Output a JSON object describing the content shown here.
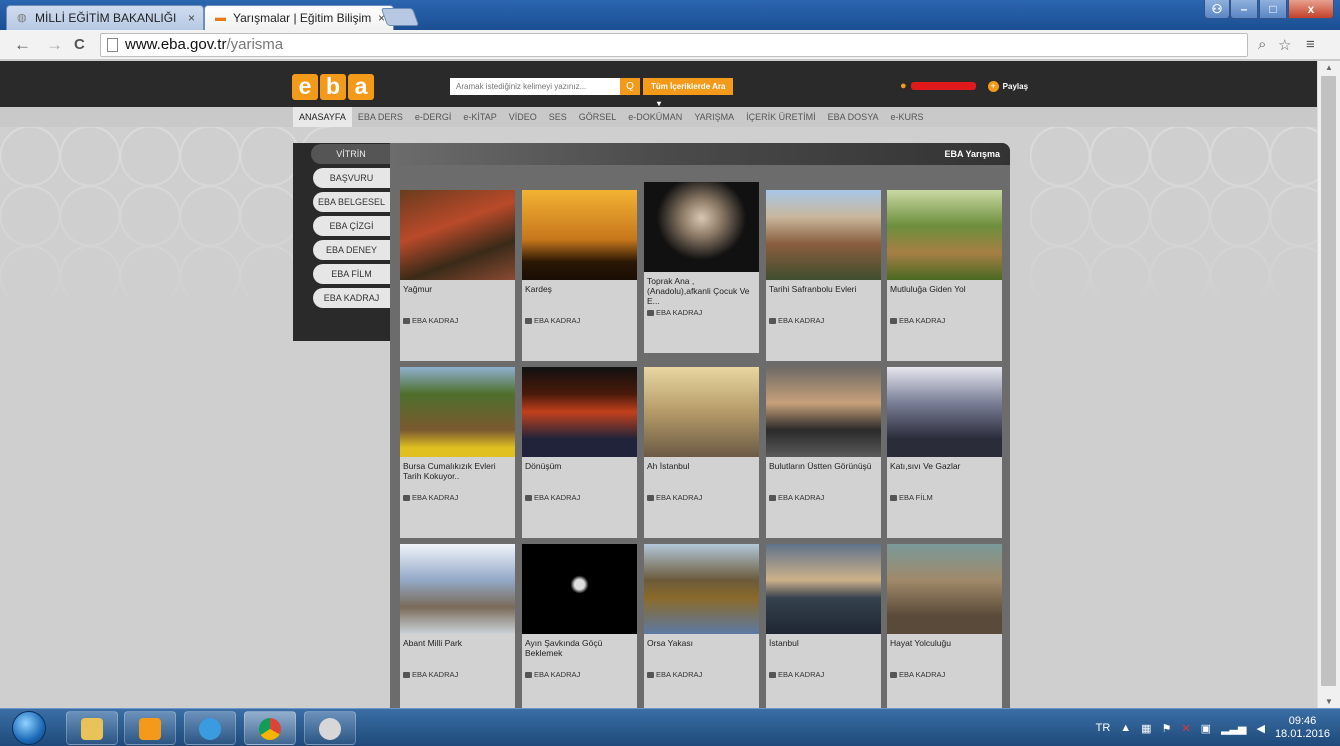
{
  "browser": {
    "tabs": [
      {
        "label": "MİLLİ EĞİTİM BAKANLIĞI",
        "close": "×"
      },
      {
        "label": "Yarışmalar | Eğitim Bilişim",
        "close": "×"
      }
    ],
    "url_host": "www.eba.gov.tr",
    "url_path": "/yarisma",
    "nav_back": "←",
    "nav_forward": "→",
    "nav_reload": "C",
    "zoom_icon": "⌕",
    "star_icon": "☆",
    "menu_icon": "≡",
    "win_min": "–",
    "win_max": "□",
    "win_close": "x"
  },
  "site": {
    "logo": [
      "e",
      "b",
      "a"
    ],
    "search_placeholder": "Aramak istediğiniz kelimeyi yazınız...",
    "search_button": "Q",
    "filter_button": "Tüm İçeriklerde Ara",
    "share_label": "Paylaş",
    "share_plus": "+",
    "nav": [
      "ANASAYFA",
      "EBA DERS",
      "e-DERGİ",
      "e-KİTAP",
      "VİDEO",
      "SES",
      "GÖRSEL",
      "e-DOKÜMAN",
      "YARIŞMA",
      "İÇERİK ÜRETİMİ",
      "EBA DOSYA",
      "e-KURS"
    ],
    "side_active": "VİTRİN",
    "side_items": [
      "BAŞVURU",
      "EBA BELGESEL",
      "EBA ÇİZGİ",
      "EBA DENEY",
      "EBA FİLM",
      "EBA KADRAJ"
    ],
    "section_title": "EBA Yarışma"
  },
  "cards": [
    {
      "title": "Yağmur",
      "category": "EBA KADRAJ"
    },
    {
      "title": "Kardeş",
      "category": "EBA KADRAJ"
    },
    {
      "title": "Toprak Ana , (Anadolu),afkanli Çocuk Ve E...",
      "category": "EBA KADRAJ"
    },
    {
      "title": "Tarihi Safranbolu Evleri",
      "category": "EBA KADRAJ"
    },
    {
      "title": "Mutluluğa Giden Yol",
      "category": "EBA KADRAJ"
    },
    {
      "title": "Bursa Cumalıkızık Evleri Tarih Kokuyor..",
      "category": "EBA KADRAJ"
    },
    {
      "title": "Dönüşüm",
      "category": "EBA KADRAJ"
    },
    {
      "title": "Ah İstanbul",
      "category": "EBA KADRAJ"
    },
    {
      "title": "Bulutların Üstten Görünüşü",
      "category": "EBA KADRAJ"
    },
    {
      "title": "Katı,sıvı Ve Gazlar",
      "category": "EBA FİLM"
    },
    {
      "title": "Abant Milli Park",
      "category": "EBA KADRAJ"
    },
    {
      "title": "Ayın Şavkında Göçü Beklemek",
      "category": "EBA KADRAJ"
    },
    {
      "title": "Orsa Yakası",
      "category": "EBA KADRAJ"
    },
    {
      "title": "İstanbul",
      "category": "EBA KADRAJ"
    },
    {
      "title": "Hayat Yolculuğu",
      "category": "EBA KADRAJ"
    }
  ],
  "taskbar": {
    "lang": "TR",
    "time": "09:46",
    "date": "18.01.2016"
  }
}
